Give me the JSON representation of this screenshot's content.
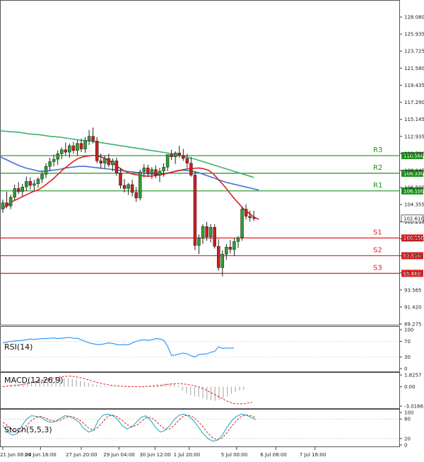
{
  "chart_data": {
    "type": "candlestick",
    "price_axis": {
      "ticks": [
        "128.080",
        "125.935",
        "123.725",
        "121.580",
        "119.435",
        "117.290",
        "115.145",
        "112.935",
        "110.790",
        "108.645",
        "106.500",
        "104.355",
        "102.210",
        "100.000",
        "97.855",
        "95.710",
        "93.565",
        "91.420",
        "89.275"
      ],
      "range": [
        89.275,
        130.1
      ],
      "current_price": "102.610"
    },
    "time_axis": {
      "labels": [
        "21 Jun 08:00",
        "24 Jun 16:00",
        "27 Jun 20:00",
        "29 Jun 04:00",
        "30 Jun 12:00",
        "1 Jul 20:00",
        "5 Jul 00:00",
        "6 Jul 08:00",
        "7 Jul 16:00"
      ],
      "label_positions": [
        0,
        9.6,
        20,
        29.6,
        38.8,
        47.5,
        59.6,
        69.6,
        79.6
      ]
    },
    "levels": [
      {
        "name": "R3",
        "value": 110.56,
        "label": "110.560",
        "color": "#1f8f1f"
      },
      {
        "name": "R2",
        "value": 108.33,
        "label": "108.330",
        "color": "#1f8f1f"
      },
      {
        "name": "R1",
        "value": 106.1,
        "label": "106.100",
        "color": "#1f8f1f"
      },
      {
        "name": "S1",
        "value": 100.15,
        "label": "100.150",
        "color": "#e02020"
      },
      {
        "name": "S2",
        "value": 97.91,
        "label": "97.910",
        "color": "#e02020"
      },
      {
        "name": "S3",
        "value": 95.68,
        "label": "95.680",
        "color": "#e02020"
      }
    ],
    "candles": [
      [
        103.8,
        105.0,
        103.3,
        104.6
      ],
      [
        104.6,
        106.0,
        103.9,
        104.2
      ],
      [
        104.2,
        105.6,
        103.8,
        105.3
      ],
      [
        105.3,
        106.9,
        104.9,
        106.4
      ],
      [
        106.4,
        107.2,
        105.7,
        106.0
      ],
      [
        106.0,
        107.0,
        105.4,
        106.6
      ],
      [
        106.6,
        107.9,
        106.1,
        107.3
      ],
      [
        107.3,
        107.8,
        106.3,
        106.8
      ],
      [
        106.8,
        107.5,
        106.1,
        107.0
      ],
      [
        107.0,
        107.8,
        106.5,
        107.6
      ],
      [
        107.6,
        108.6,
        107.1,
        108.2
      ],
      [
        108.2,
        109.6,
        107.7,
        109.2
      ],
      [
        109.2,
        110.3,
        108.6,
        109.8
      ],
      [
        109.8,
        110.7,
        109.2,
        110.1
      ],
      [
        110.1,
        111.2,
        109.4,
        110.8
      ],
      [
        110.8,
        111.6,
        110.1,
        111.3
      ],
      [
        111.3,
        112.2,
        110.6,
        111.0
      ],
      [
        111.0,
        112.1,
        110.3,
        111.8
      ],
      [
        111.8,
        112.3,
        110.8,
        111.2
      ],
      [
        111.2,
        112.5,
        110.5,
        112.1
      ],
      [
        112.1,
        112.7,
        111.0,
        111.4
      ],
      [
        111.4,
        112.9,
        110.9,
        112.5
      ],
      [
        112.5,
        113.8,
        111.9,
        113.0
      ],
      [
        113.0,
        114.1,
        112.1,
        112.4
      ],
      [
        112.4,
        112.9,
        109.6,
        109.9
      ],
      [
        109.9,
        110.8,
        108.9,
        109.6
      ],
      [
        109.6,
        110.6,
        108.9,
        110.2
      ],
      [
        110.2,
        110.8,
        109.1,
        109.4
      ],
      [
        109.4,
        110.2,
        108.6,
        109.9
      ],
      [
        109.9,
        110.3,
        108.0,
        108.4
      ],
      [
        108.4,
        109.0,
        106.4,
        106.8
      ],
      [
        106.8,
        107.6,
        105.9,
        106.4
      ],
      [
        106.4,
        107.1,
        105.6,
        106.9
      ],
      [
        106.9,
        107.5,
        105.4,
        105.9
      ],
      [
        105.9,
        106.6,
        104.7,
        105.2
      ],
      [
        105.2,
        108.8,
        104.9,
        108.5
      ],
      [
        108.5,
        109.5,
        107.8,
        109.0
      ],
      [
        109.0,
        109.4,
        107.9,
        108.3
      ],
      [
        108.3,
        109.1,
        107.6,
        108.8
      ],
      [
        108.8,
        109.3,
        107.7,
        108.1
      ],
      [
        108.1,
        109.0,
        107.2,
        108.6
      ],
      [
        108.6,
        109.6,
        107.9,
        109.1
      ],
      [
        109.1,
        110.4,
        108.6,
        110.7
      ],
      [
        110.7,
        111.3,
        110.0,
        110.4
      ],
      [
        110.4,
        111.1,
        109.5,
        110.9
      ],
      [
        110.9,
        111.8,
        110.3,
        110.6
      ],
      [
        110.6,
        111.4,
        109.9,
        110.2
      ],
      [
        110.2,
        110.8,
        109.0,
        109.6
      ],
      [
        109.6,
        110.4,
        107.9,
        108.1
      ],
      [
        108.1,
        108.6,
        98.6,
        99.2
      ],
      [
        99.2,
        100.6,
        98.1,
        100.1
      ],
      [
        100.1,
        101.9,
        99.4,
        101.6
      ],
      [
        101.6,
        102.2,
        99.8,
        100.3
      ],
      [
        100.3,
        101.9,
        99.6,
        101.5
      ],
      [
        101.5,
        101.9,
        98.8,
        99.1
      ],
      [
        99.1,
        100.0,
        96.0,
        96.4
      ],
      [
        96.4,
        98.6,
        95.3,
        98.1
      ],
      [
        98.1,
        99.4,
        97.4,
        99.0
      ],
      [
        99.0,
        99.9,
        98.2,
        98.7
      ],
      [
        98.7,
        100.1,
        97.9,
        99.7
      ],
      [
        99.7,
        100.4,
        98.9,
        100.2
      ],
      [
        100.2,
        104.1,
        99.8,
        103.8
      ],
      [
        103.8,
        104.4,
        102.5,
        102.9
      ],
      [
        102.9,
        103.6,
        102.2,
        102.7
      ],
      [
        102.7,
        103.6,
        102.3,
        102.61
      ]
    ],
    "ma_red": [
      103.9,
      104.3,
      104.8,
      105.1,
      105.4,
      105.7,
      106.0,
      106.2,
      106.6,
      107.1,
      107.6,
      108.2,
      108.8,
      109.3,
      109.8,
      110.2,
      110.4,
      110.5,
      110.6,
      110.5,
      110.3,
      110.0,
      109.6,
      109.1,
      108.7,
      108.4,
      108.2,
      108.1,
      108.0,
      107.95,
      108.0,
      108.1,
      108.2,
      108.35,
      108.5,
      108.65,
      108.8,
      108.9,
      108.95,
      109.0,
      108.9,
      108.7,
      108.2,
      107.5,
      106.8,
      106.0,
      105.2,
      104.5,
      103.8,
      103.3,
      102.8,
      102.5
    ],
    "ma_blue": [
      110.5,
      110.1,
      109.7,
      109.3,
      109.0,
      108.8,
      108.6,
      108.6,
      108.7,
      108.8,
      109.0,
      109.1,
      109.2,
      109.2,
      109.1,
      109.0,
      108.9,
      108.8,
      108.7,
      108.6,
      108.5,
      108.4,
      108.3,
      108.25,
      108.2,
      108.3,
      108.5,
      108.7,
      108.7,
      108.6,
      108.4,
      108.1,
      107.8,
      107.5,
      107.2,
      107.0,
      106.8,
      106.6,
      106.4,
      106.2
    ],
    "ma_green": [
      113.7,
      113.6,
      113.5,
      113.3,
      113.2,
      113.0,
      112.9,
      112.7,
      112.5,
      112.4,
      112.2,
      112.0,
      111.8,
      111.6,
      111.4,
      111.2,
      111.0,
      110.8,
      110.5,
      110.2,
      109.8,
      109.4,
      109.0,
      108.6,
      108.2,
      107.8
    ],
    "rsi": {
      "title": "RSI(14)",
      "ticks": [
        "100",
        "70",
        "30",
        "0"
      ],
      "values": [
        66,
        68,
        70,
        71,
        72,
        73,
        74,
        76,
        75,
        76,
        77,
        77,
        78,
        79,
        77,
        78,
        79,
        80,
        78,
        78,
        74,
        70,
        66,
        64,
        62,
        62,
        64,
        66,
        65,
        62,
        61,
        62,
        61,
        66,
        70,
        73,
        74,
        73,
        74,
        77,
        76,
        73,
        58,
        34,
        35,
        38,
        40,
        38,
        33,
        30,
        36,
        37,
        38,
        42,
        44,
        56,
        52,
        53,
        53,
        53
      ]
    },
    "macd": {
      "title": "MACD(12,26,9)",
      "ticks": [
        "1.8257",
        "0.00",
        "-3.0166"
      ],
      "histogram": [
        0.1,
        0.2,
        0.3,
        0.4,
        0.5,
        0.6,
        0.7,
        0.9,
        1.0,
        1.1,
        1.2,
        1.3,
        1.35,
        1.4,
        1.4,
        1.35,
        1.3,
        1.25,
        1.1,
        0.95,
        0.8,
        0.6,
        0.4,
        0.3,
        0.2,
        0.15,
        0.1,
        0.05,
        0.02,
        0.0,
        -0.05,
        -0.1,
        -0.05,
        0.0,
        0.05,
        0.1,
        0.2,
        0.3,
        0.4,
        0.45,
        0.5,
        0.5,
        0.45,
        0.2,
        -0.6,
        -1.0,
        -1.3,
        -1.5,
        -1.6,
        -1.8,
        -2.0,
        -2.1,
        -2.2,
        -2.0,
        -1.8,
        -1.5,
        -1.1,
        -0.8,
        -0.6,
        -0.5
      ],
      "signal": [
        0.0,
        0.1,
        0.2,
        0.3,
        0.5,
        0.7,
        0.9,
        1.1,
        1.3,
        1.45,
        1.6,
        1.65,
        1.55,
        1.35,
        1.1,
        0.8,
        0.55,
        0.35,
        0.2,
        0.1,
        0.05,
        0.02,
        0.0,
        0.0,
        0.05,
        0.1,
        0.2,
        0.35,
        0.45,
        0.5,
        0.4,
        0.25,
        0.05,
        -0.3,
        -0.8,
        -1.3,
        -1.8,
        -2.3,
        -2.6,
        -2.7,
        -2.6,
        -2.4
      ]
    },
    "stoch": {
      "title": "Stoch(5,5,3)",
      "ticks": [
        "100",
        "80",
        "20",
        "0"
      ],
      "k": [
        60,
        40,
        30,
        35,
        60,
        80,
        90,
        88,
        85,
        75,
        70,
        72,
        82,
        90,
        88,
        80,
        70,
        50,
        40,
        45,
        75,
        92,
        95,
        90,
        80,
        60,
        50,
        55,
        70,
        85,
        90,
        75,
        55,
        40,
        45,
        60,
        80,
        92,
        95,
        88,
        75,
        55,
        35,
        20,
        12,
        15,
        30,
        55,
        75,
        88,
        95,
        92,
        85,
        78
      ],
      "d": [
        70,
        60,
        45,
        38,
        45,
        60,
        75,
        85,
        88,
        82,
        76,
        73,
        76,
        84,
        88,
        85,
        78,
        65,
        52,
        46,
        55,
        72,
        88,
        92,
        87,
        76,
        63,
        56,
        60,
        72,
        84,
        85,
        75,
        60,
        48,
        50,
        62,
        78,
        90,
        91,
        85,
        72,
        55,
        36,
        22,
        16,
        22,
        38,
        58,
        75,
        88,
        92,
        90,
        84
      ]
    }
  }
}
